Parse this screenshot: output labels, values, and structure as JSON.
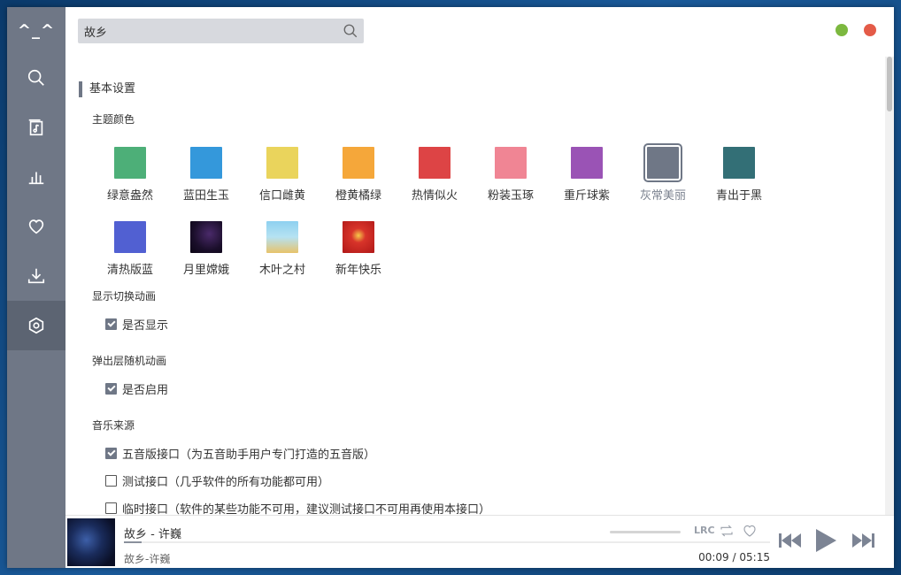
{
  "app": {
    "logo": "^_^"
  },
  "sidebar": {
    "items": [
      {
        "icon": "search-icon"
      },
      {
        "icon": "music-list-icon"
      },
      {
        "icon": "chart-icon"
      },
      {
        "icon": "heart-icon"
      },
      {
        "icon": "download-icon"
      },
      {
        "icon": "settings-icon",
        "active": true
      }
    ]
  },
  "search": {
    "value": "故乡",
    "placeholder": ""
  },
  "window": {
    "green_color": "#7cb83f",
    "red_color": "#e45b48"
  },
  "settings": {
    "section_title": "基本设置",
    "theme_label": "主题颜色",
    "themes": [
      {
        "name": "绿意盎然",
        "color": "#4daf78"
      },
      {
        "name": "蓝田生玉",
        "color": "#3498db"
      },
      {
        "name": "信口雌黄",
        "color": "#ead45c"
      },
      {
        "name": "橙黄橘绿",
        "color": "#f5a73a"
      },
      {
        "name": "热情似火",
        "color": "#dd4445"
      },
      {
        "name": "粉装玉琢",
        "color": "#f08594"
      },
      {
        "name": "重斤球紫",
        "color": "#9a53b5"
      },
      {
        "name": "灰常美丽",
        "color": "#6f7786",
        "selected": true
      },
      {
        "name": "青出于黑",
        "color": "#336f76"
      },
      {
        "name": "清热版蓝",
        "color": "#5160d2"
      },
      {
        "name": "月里嫦娥",
        "color": "#201431"
      },
      {
        "name": "木叶之村",
        "color": "#8ac6e8"
      },
      {
        "name": "新年快乐",
        "color": "#c42222"
      }
    ],
    "animation_label": "显示切换动画",
    "animation_option": "是否显示",
    "animation_checked": true,
    "popup_label": "弹出层随机动画",
    "popup_option": "是否启用",
    "popup_checked": true,
    "source_label": "音乐来源",
    "sources": [
      {
        "label": "五音版接口（为五音助手用户专门打造的五音版）",
        "checked": true
      },
      {
        "label": "测试接口（几乎软件的所有功能都可用）",
        "checked": false
      },
      {
        "label": "临时接口（软件的某些功能不可用，建议测试接口不可用再使用本接口）",
        "checked": false
      }
    ]
  },
  "player": {
    "title": "故乡 - 许巍",
    "subtitle": "故乡-许巍",
    "current_time": "00:09",
    "separator": "/",
    "total_time": "05:15",
    "progress": 0.028,
    "lrc_label": "LRC"
  }
}
